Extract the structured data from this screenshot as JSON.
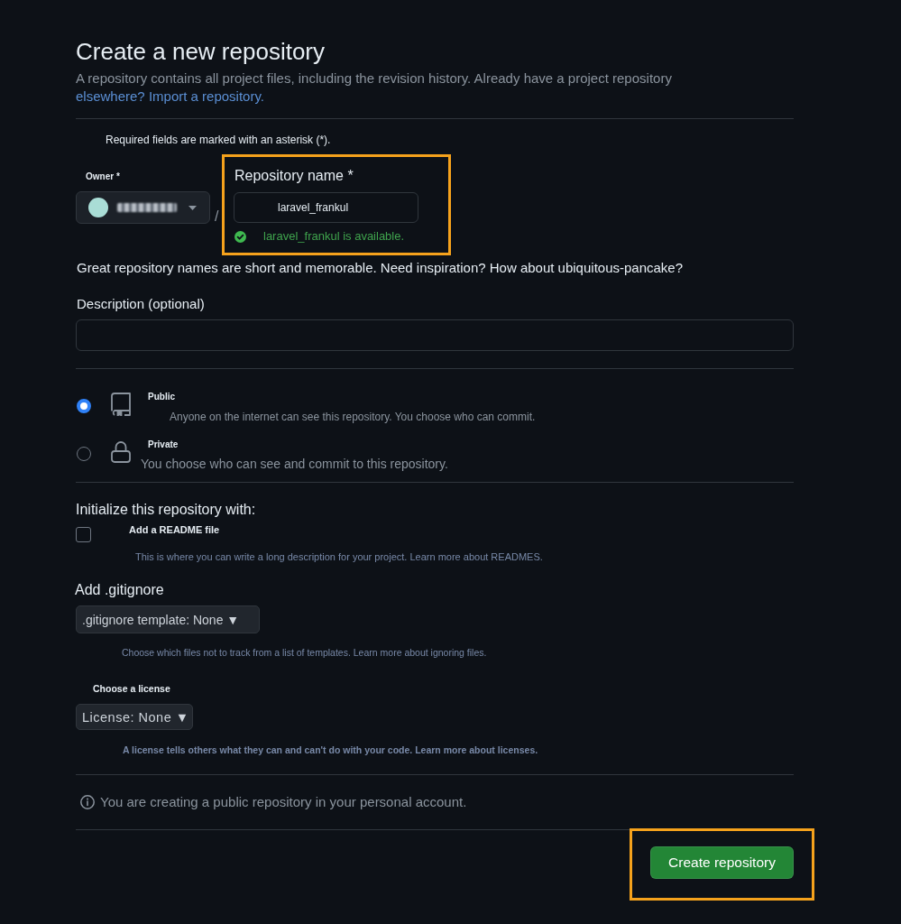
{
  "header": {
    "title": "Create a new repository",
    "description": "A repository contains all project files, including the revision history. Already have a project repository",
    "link": "elsewhere? Import a repository."
  },
  "required_note": "Required fields are marked with an asterisk (*).",
  "owner": {
    "label": "Owner *"
  },
  "separator": "/",
  "repository_name": {
    "label": "Repository name *",
    "value": "laravel_frankul",
    "available": true,
    "status": "laravel_frankul is available.",
    "highlighted": true
  },
  "name_hint": "Great repository names are short and memorable. Need inspiration? How about ubiquitous-pancake?",
  "description": {
    "label": "Description (optional)"
  },
  "visibility": [
    {
      "kind": "public",
      "label": "Public",
      "description": "Anyone on the internet can see this repository. You choose who can commit.",
      "selected": true
    },
    {
      "kind": "private",
      "label": "Private",
      "description": "You choose who can see and commit to this repository.",
      "selected": false
    }
  ],
  "initialize": {
    "heading": "Initialize this repository with:",
    "readme": {
      "label": "Add a README file",
      "checked": false,
      "hint": "This is where you can write a long description for your project. Learn more about READMES."
    }
  },
  "gitignore": {
    "heading": "Add .gitignore",
    "select": ".gitignore template: None ▼",
    "hint": "Choose which files not to track from a list of templates. Learn more about ignoring files."
  },
  "license": {
    "label": "Choose a license",
    "select": "License: None ▼",
    "hint": "A license tells others what they can and can't do with your code. Learn more about licenses."
  },
  "notice": "You are creating a public repository in your personal account.",
  "submit": {
    "label": "Create repository",
    "highlighted": true
  }
}
